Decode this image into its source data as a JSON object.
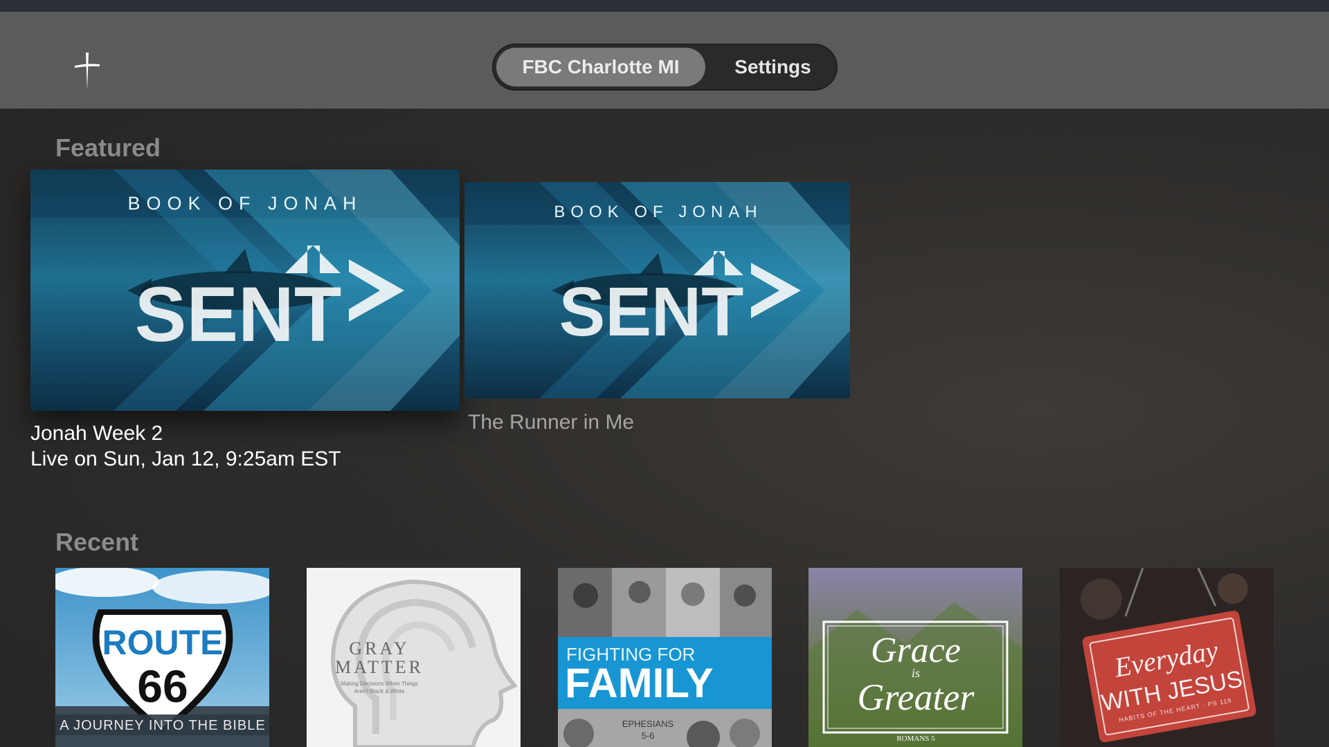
{
  "header": {
    "tabs": [
      {
        "label": "FBC Charlotte MI",
        "selected": true
      },
      {
        "label": "Settings",
        "selected": false
      }
    ]
  },
  "featured": {
    "title": "Featured",
    "items": [
      {
        "art_top": "BOOK OF JONAH",
        "art_main": "SENT",
        "title": "Jonah Week 2",
        "subtitle": "Live on Sun, Jan 12, 9:25am EST",
        "focused": true
      },
      {
        "art_top": "BOOK OF JONAH",
        "art_main": "SENT",
        "title": "The Runner in Me",
        "focused": false
      }
    ]
  },
  "recent": {
    "title": "Recent",
    "items": [
      {
        "art_main": "ROUTE",
        "art_number": "66",
        "art_sub": "A JOURNEY INTO THE BIBLE"
      },
      {
        "art_main": "GRAY",
        "art_main2": "MATTER",
        "art_sub": "Making Decisions When Things",
        "art_sub2": "Aren't Black & White"
      },
      {
        "art_main": "FIGHTING FOR",
        "art_main2": "FAMILY",
        "art_sub": "EPHESIANS",
        "art_sub2": "5-6"
      },
      {
        "art_main": "Grace",
        "art_mid": "is",
        "art_main2": "Greater",
        "art_sub": "ROMANS 5"
      },
      {
        "art_main": "Everyday",
        "art_main2": "WITH JESUS",
        "art_sub": "HABITS OF THE HEART · PS 119"
      }
    ]
  },
  "colors": {
    "accent": "#1da1de",
    "header_bg": "#5c5b5b",
    "segment_bg": "#2a2a2c",
    "segment_selected": "#7a7a7c"
  }
}
